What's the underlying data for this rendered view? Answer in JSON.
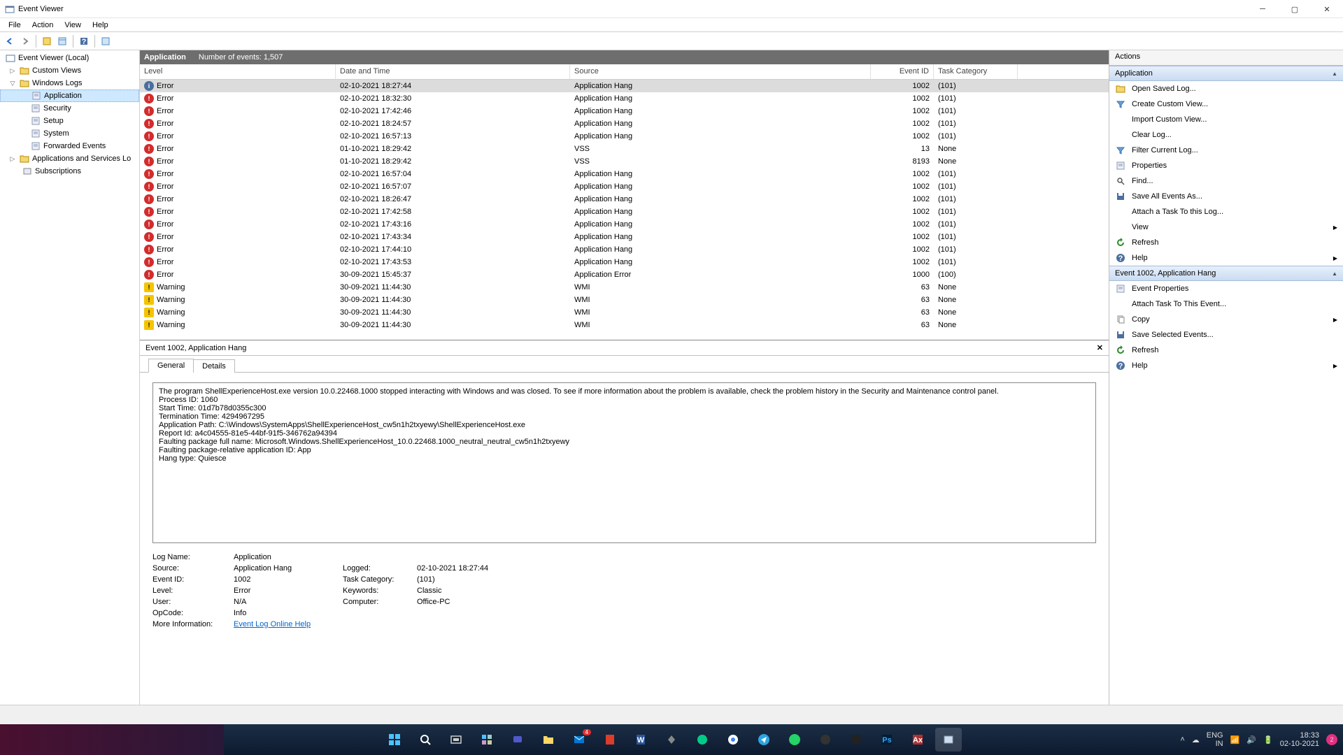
{
  "window_title": "Event Viewer",
  "menus": [
    "File",
    "Action",
    "View",
    "Help"
  ],
  "tree": {
    "root": "Event Viewer (Local)",
    "custom_views": "Custom Views",
    "windows_logs": "Windows Logs",
    "logs": [
      "Application",
      "Security",
      "Setup",
      "System",
      "Forwarded Events"
    ],
    "apps_services": "Applications and Services Lo",
    "subscriptions": "Subscriptions"
  },
  "grid_header": {
    "title": "Application",
    "count_label": "Number of events: 1,507"
  },
  "grid_columns": {
    "level": "Level",
    "date": "Date and Time",
    "source": "Source",
    "eid": "Event ID",
    "tc": "Task Category"
  },
  "events": [
    {
      "level": "Error",
      "icon": "info",
      "date": "02-10-2021 18:27:44",
      "source": "Application Hang",
      "eid": "1002",
      "tc": "(101)",
      "sel": true
    },
    {
      "level": "Error",
      "icon": "err",
      "date": "02-10-2021 18:32:30",
      "source": "Application Hang",
      "eid": "1002",
      "tc": "(101)"
    },
    {
      "level": "Error",
      "icon": "err",
      "date": "02-10-2021 17:42:46",
      "source": "Application Hang",
      "eid": "1002",
      "tc": "(101)"
    },
    {
      "level": "Error",
      "icon": "err",
      "date": "02-10-2021 18:24:57",
      "source": "Application Hang",
      "eid": "1002",
      "tc": "(101)"
    },
    {
      "level": "Error",
      "icon": "err",
      "date": "02-10-2021 16:57:13",
      "source": "Application Hang",
      "eid": "1002",
      "tc": "(101)"
    },
    {
      "level": "Error",
      "icon": "err",
      "date": "01-10-2021 18:29:42",
      "source": "VSS",
      "eid": "13",
      "tc": "None"
    },
    {
      "level": "Error",
      "icon": "err",
      "date": "01-10-2021 18:29:42",
      "source": "VSS",
      "eid": "8193",
      "tc": "None"
    },
    {
      "level": "Error",
      "icon": "err",
      "date": "02-10-2021 16:57:04",
      "source": "Application Hang",
      "eid": "1002",
      "tc": "(101)"
    },
    {
      "level": "Error",
      "icon": "err",
      "date": "02-10-2021 16:57:07",
      "source": "Application Hang",
      "eid": "1002",
      "tc": "(101)"
    },
    {
      "level": "Error",
      "icon": "err",
      "date": "02-10-2021 18:26:47",
      "source": "Application Hang",
      "eid": "1002",
      "tc": "(101)"
    },
    {
      "level": "Error",
      "icon": "err",
      "date": "02-10-2021 17:42:58",
      "source": "Application Hang",
      "eid": "1002",
      "tc": "(101)"
    },
    {
      "level": "Error",
      "icon": "err",
      "date": "02-10-2021 17:43:16",
      "source": "Application Hang",
      "eid": "1002",
      "tc": "(101)"
    },
    {
      "level": "Error",
      "icon": "err",
      "date": "02-10-2021 17:43:34",
      "source": "Application Hang",
      "eid": "1002",
      "tc": "(101)"
    },
    {
      "level": "Error",
      "icon": "err",
      "date": "02-10-2021 17:44:10",
      "source": "Application Hang",
      "eid": "1002",
      "tc": "(101)"
    },
    {
      "level": "Error",
      "icon": "err",
      "date": "02-10-2021 17:43:53",
      "source": "Application Hang",
      "eid": "1002",
      "tc": "(101)"
    },
    {
      "level": "Error",
      "icon": "err",
      "date": "30-09-2021 15:45:37",
      "source": "Application Error",
      "eid": "1000",
      "tc": "(100)"
    },
    {
      "level": "Warning",
      "icon": "warn",
      "date": "30-09-2021 11:44:30",
      "source": "WMI",
      "eid": "63",
      "tc": "None"
    },
    {
      "level": "Warning",
      "icon": "warn",
      "date": "30-09-2021 11:44:30",
      "source": "WMI",
      "eid": "63",
      "tc": "None"
    },
    {
      "level": "Warning",
      "icon": "warn",
      "date": "30-09-2021 11:44:30",
      "source": "WMI",
      "eid": "63",
      "tc": "None"
    },
    {
      "level": "Warning",
      "icon": "warn",
      "date": "30-09-2021 11:44:30",
      "source": "WMI",
      "eid": "63",
      "tc": "None"
    }
  ],
  "detail_title": "Event 1002, Application Hang",
  "tabs": {
    "general": "General",
    "details": "Details"
  },
  "message": "The program ShellExperienceHost.exe version 10.0.22468.1000 stopped interacting with Windows and was closed. To see if more information about the problem is available, check the problem history in the Security and Maintenance control panel.\nProcess ID: 1060\nStart Time: 01d7b78d0355c300\nTermination Time: 4294967295\nApplication Path: C:\\Windows\\SystemApps\\ShellExperienceHost_cw5n1h2txyewy\\ShellExperienceHost.exe\nReport Id: a4c04555-81e5-44bf-91f5-346762a94394\nFaulting package full name: Microsoft.Windows.ShellExperienceHost_10.0.22468.1000_neutral_neutral_cw5n1h2txyewy\nFaulting package-relative application ID: App\nHang type: Quiesce",
  "props": {
    "log_name": {
      "k": "Log Name:",
      "v": "Application"
    },
    "source": {
      "k": "Source:",
      "v": "Application Hang"
    },
    "logged": {
      "k": "Logged:",
      "v": "02-10-2021 18:27:44"
    },
    "event_id": {
      "k": "Event ID:",
      "v": "1002"
    },
    "task_cat": {
      "k": "Task Category:",
      "v": "(101)"
    },
    "level": {
      "k": "Level:",
      "v": "Error"
    },
    "keywords": {
      "k": "Keywords:",
      "v": "Classic"
    },
    "user": {
      "k": "User:",
      "v": "N/A"
    },
    "computer": {
      "k": "Computer:",
      "v": "Office-PC"
    },
    "opcode": {
      "k": "OpCode:",
      "v": "Info"
    },
    "more_info": {
      "k": "More Information:",
      "v": "Event Log Online Help"
    }
  },
  "actions_title": "Actions",
  "section1": "Application",
  "section2": "Event 1002, Application Hang",
  "acts1": [
    {
      "label": "Open Saved Log...",
      "icon": "folder"
    },
    {
      "label": "Create Custom View...",
      "icon": "filter"
    },
    {
      "label": "Import Custom View...",
      "icon": "blank"
    },
    {
      "label": "Clear Log...",
      "icon": "blank"
    },
    {
      "label": "Filter Current Log...",
      "icon": "filter"
    },
    {
      "label": "Properties",
      "icon": "props"
    },
    {
      "label": "Find...",
      "icon": "find"
    },
    {
      "label": "Save All Events As...",
      "icon": "save"
    },
    {
      "label": "Attach a Task To this Log...",
      "icon": "blank"
    },
    {
      "label": "View",
      "icon": "blank",
      "sub": true
    },
    {
      "label": "Refresh",
      "icon": "refresh"
    },
    {
      "label": "Help",
      "icon": "help",
      "sub": true
    }
  ],
  "acts2": [
    {
      "label": "Event Properties",
      "icon": "props"
    },
    {
      "label": "Attach Task To This Event...",
      "icon": "blank"
    },
    {
      "label": "Copy",
      "icon": "copy",
      "sub": true
    },
    {
      "label": "Save Selected Events...",
      "icon": "save"
    },
    {
      "label": "Refresh",
      "icon": "refresh"
    },
    {
      "label": "Help",
      "icon": "help",
      "sub": true
    }
  ],
  "systray": {
    "lang1": "ENG",
    "lang2": "IN",
    "time": "18:33",
    "date": "02-10-2021"
  }
}
